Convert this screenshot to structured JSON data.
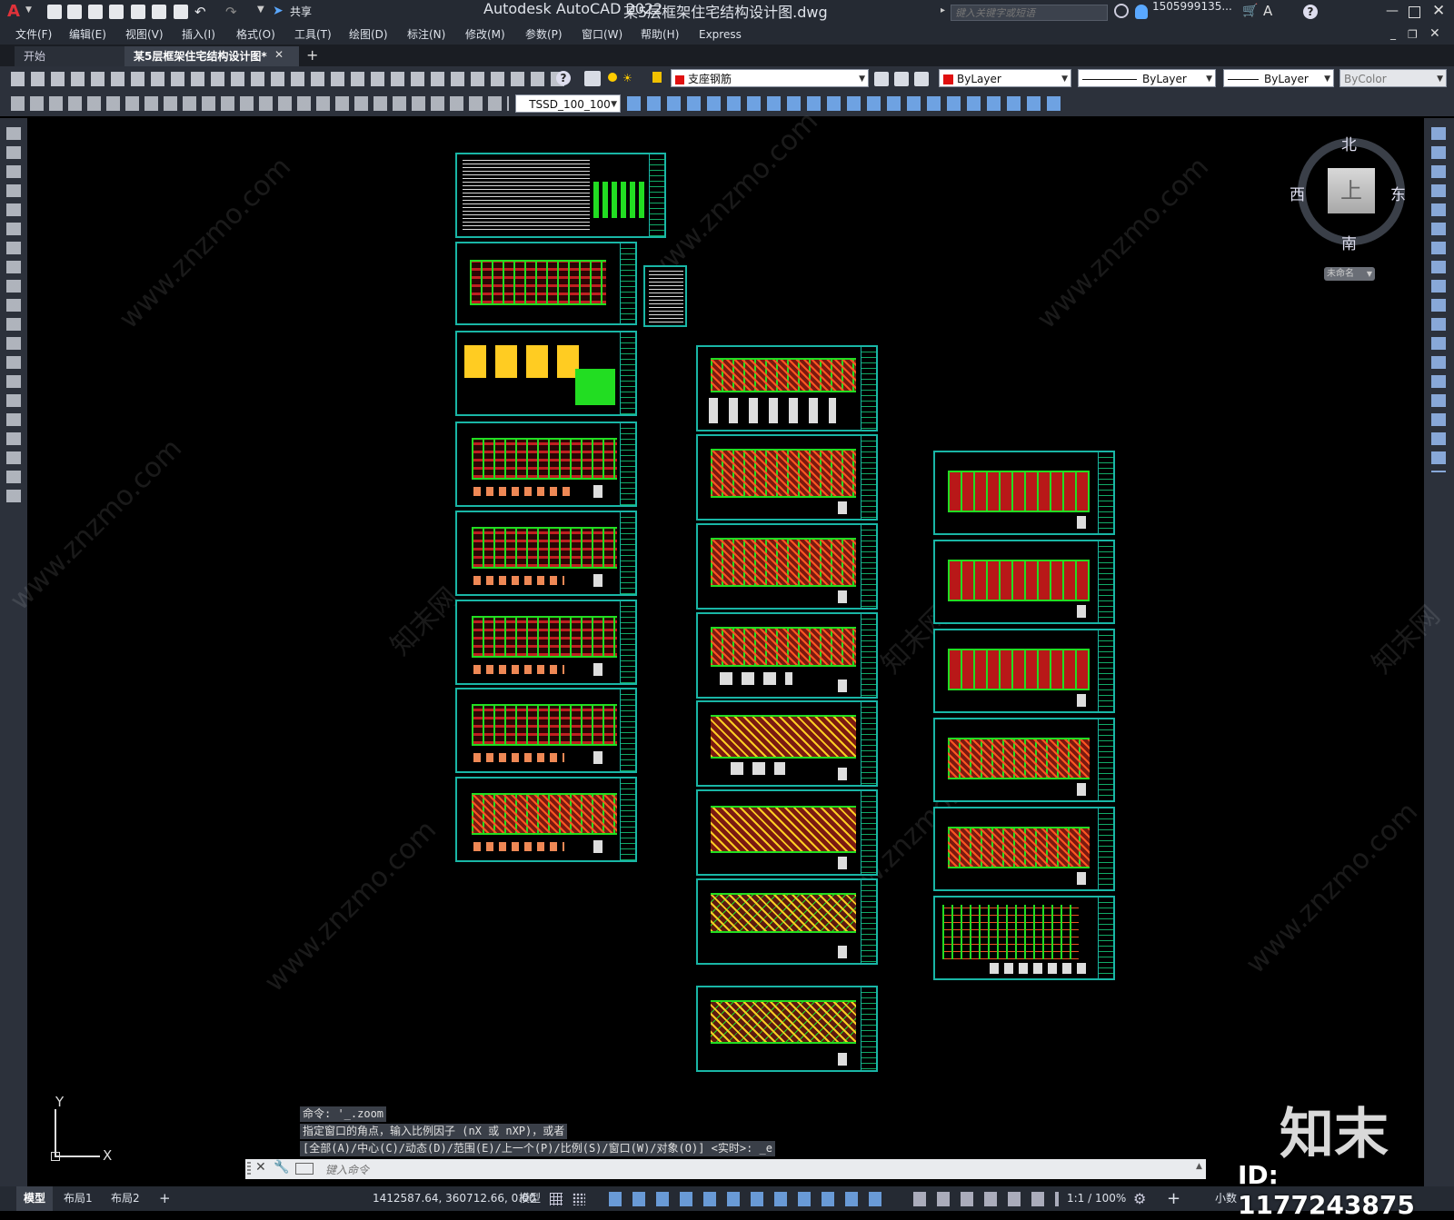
{
  "titlebar": {
    "app_title": "Autodesk AutoCAD 2022",
    "file_title": "某5层框架住宅结构设计图.dwg",
    "share_label": "共享",
    "search_placeholder": "键入关键字或短语",
    "user": "1505999135...",
    "logo_letter": "A"
  },
  "menu": [
    "文件(F)",
    "编辑(E)",
    "视图(V)",
    "插入(I)",
    "格式(O)",
    "工具(T)",
    "绘图(D)",
    "标注(N)",
    "修改(M)",
    "参数(P)",
    "窗口(W)",
    "帮助(H)",
    "Express"
  ],
  "tabs": {
    "start": "开始",
    "active": "某5层框架住宅结构设计图*"
  },
  "properties": {
    "layer": "支座钢筋",
    "layer_color": "#e01010",
    "color": "ByLayer",
    "linetype": "ByLayer",
    "lineweight": "ByLayer",
    "plotstyle": "ByColor",
    "dimstyle": "TSSD_100_100"
  },
  "viewcube": {
    "north": "北",
    "south": "南",
    "east": "东",
    "west": "西",
    "top": "上",
    "wcs": "未命名"
  },
  "ucs": {
    "x": "X",
    "y": "Y"
  },
  "command": {
    "history": [
      "命令: '_.zoom",
      "指定窗口的角点，输入比例因子 (nX 或 nXP)，或者",
      "[全部(A)/中心(C)/动态(D)/范围(E)/上一个(P)/比例(S)/窗口(W)/对象(O)] <实时>: _e"
    ],
    "placeholder": "键入命令"
  },
  "layout_tabs": [
    "模型",
    "布局1",
    "布局2"
  ],
  "status": {
    "coords": "1412587.64, 360712.66, 0.00",
    "model": "模型",
    "scale": "1:1 / 100%",
    "units": "小数"
  },
  "watermark": {
    "site": "www.znzmo.com",
    "brand": "知末网",
    "logo": "知末",
    "id": "ID: 1177243875"
  }
}
